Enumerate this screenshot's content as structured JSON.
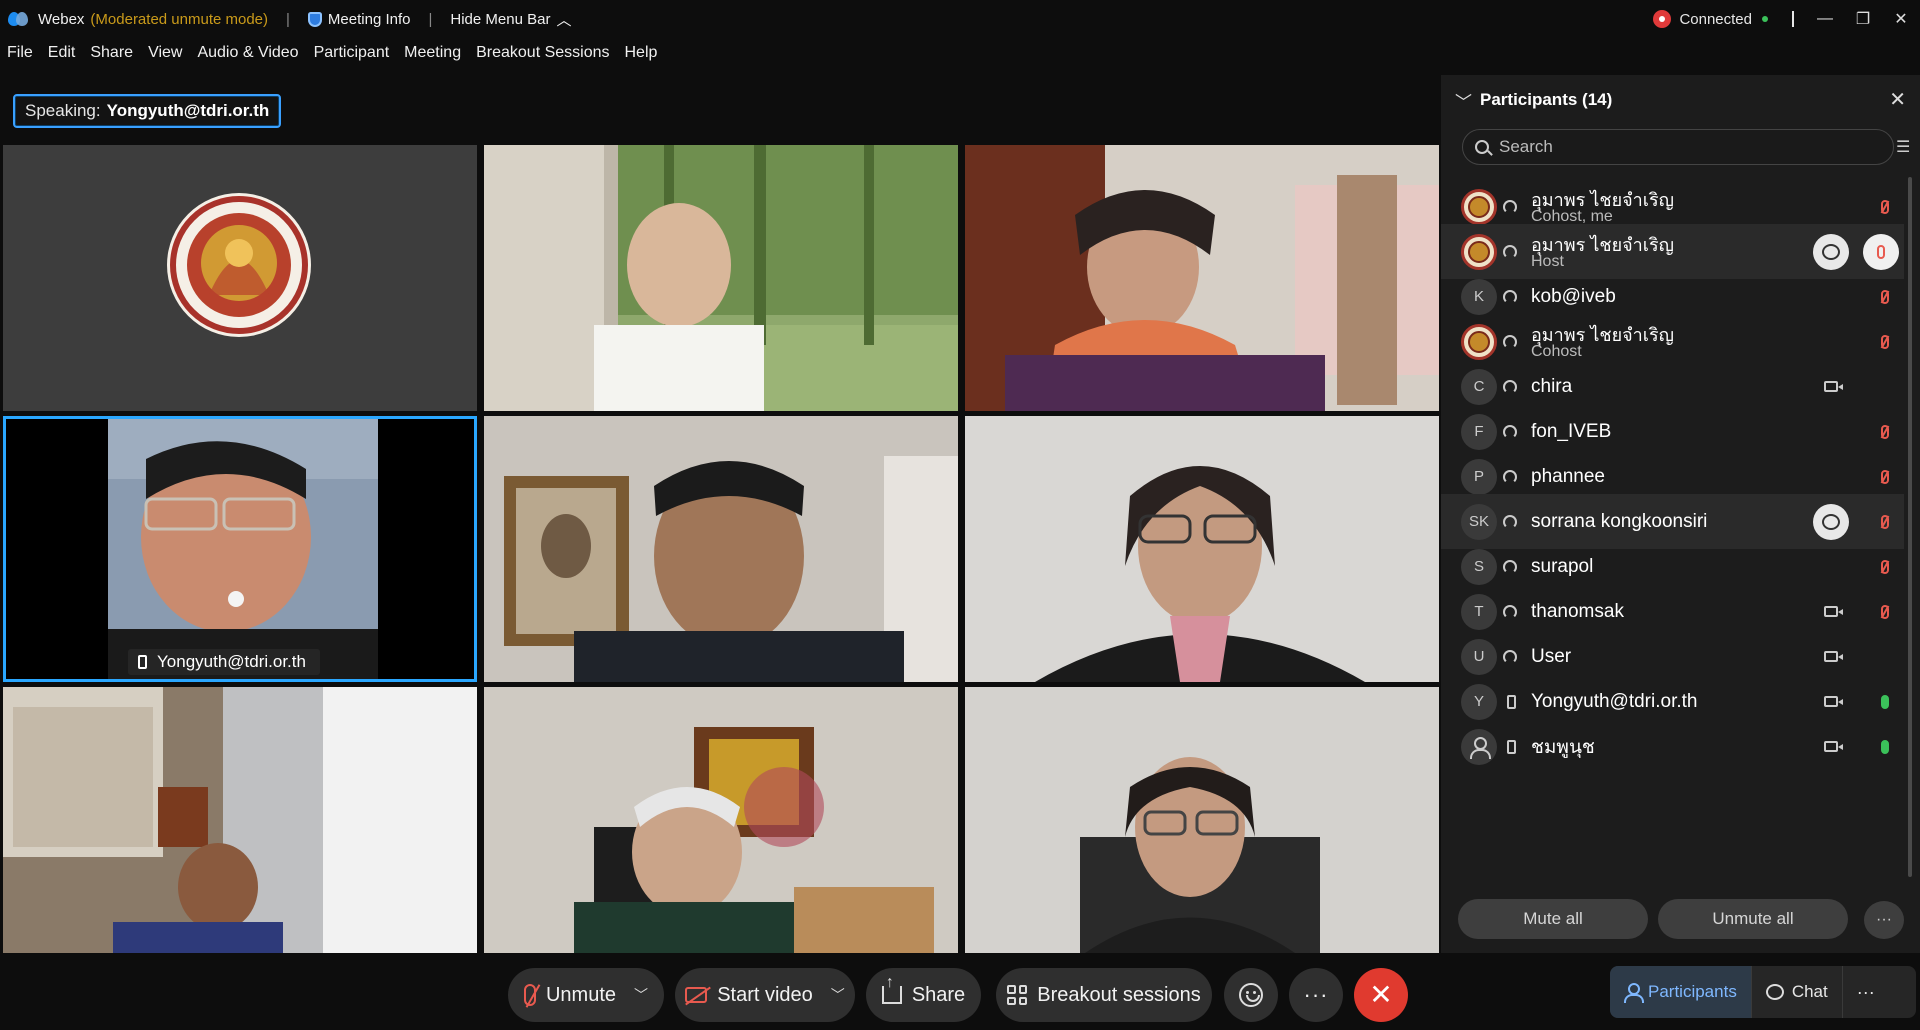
{
  "titlebar": {
    "app_name": "Webex",
    "mode": "(Moderated unmute mode)",
    "meeting_info": "Meeting Info",
    "hide_menu": "Hide Menu Bar",
    "status": "Connected"
  },
  "menu": [
    "File",
    "Edit",
    "Share",
    "View",
    "Audio & Video",
    "Participant",
    "Meeting",
    "Breakout Sessions",
    "Help"
  ],
  "speaking": {
    "label": "Speaking:",
    "name": "Yongyuth@tdri.or.th"
  },
  "active_tile": {
    "name": "Yongyuth@tdri.or.th"
  },
  "controls": {
    "unmute": "Unmute",
    "start_video": "Start video",
    "share": "Share",
    "breakout": "Breakout sessions"
  },
  "panel": {
    "title": "Participants (14)",
    "search_placeholder": "Search",
    "participants": [
      {
        "name": "อุมาพร ไชยจำเริญ",
        "role": "Cohost, me",
        "avatar": "logo",
        "device": "headset",
        "mic": "muted"
      },
      {
        "name": "อุมาพร ไชยจำเริญ",
        "role": "Host",
        "avatar": "logo",
        "device": "headset",
        "mic": "muted-button"
      },
      {
        "name": "kob@iveb",
        "role": "",
        "avatar": "K",
        "device": "headset",
        "mic": "muted"
      },
      {
        "name": "อุมาพร ไชยจำเริญ",
        "role": "Cohost",
        "avatar": "logo",
        "device": "headset",
        "mic": "muted"
      },
      {
        "name": "chira",
        "role": "",
        "avatar": "C",
        "device": "headset",
        "video": true
      },
      {
        "name": "fon_IVEB",
        "role": "",
        "avatar": "F",
        "device": "headset",
        "mic": "muted"
      },
      {
        "name": "phannee",
        "role": "",
        "avatar": "P",
        "device": "headset",
        "mic": "muted"
      },
      {
        "name": "sorrana kongkoonsiri",
        "role": "",
        "avatar": "SK",
        "device": "headset",
        "mic": "muted"
      },
      {
        "name": "surapol",
        "role": "",
        "avatar": "S",
        "device": "headset",
        "mic": "muted"
      },
      {
        "name": "thanomsak",
        "role": "",
        "avatar": "T",
        "device": "headset",
        "video": true,
        "mic": "muted"
      },
      {
        "name": "User",
        "role": "",
        "avatar": "U",
        "device": "headset",
        "video": true
      },
      {
        "name": "Yongyuth@tdri.or.th",
        "role": "",
        "avatar": "Y",
        "device": "phone",
        "video": true,
        "mic": "on"
      },
      {
        "name": "ชมพูนุช",
        "role": "",
        "avatar": "guest",
        "device": "phone",
        "video": true,
        "mic": "on"
      }
    ],
    "mute_all": "Mute all",
    "unmute_all": "Unmute all"
  },
  "tabs": {
    "participants": "Participants",
    "chat": "Chat"
  }
}
